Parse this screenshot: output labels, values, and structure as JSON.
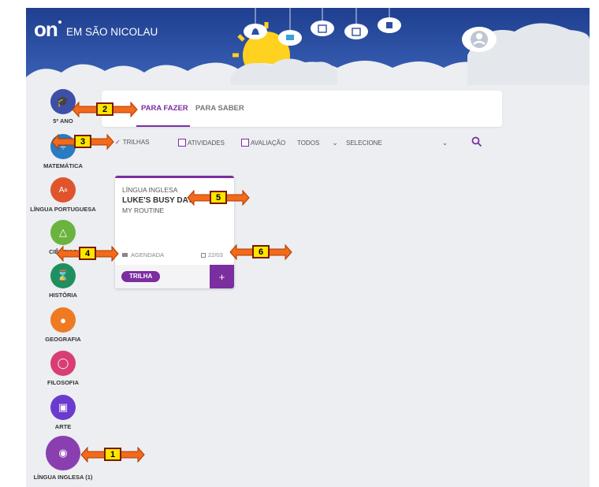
{
  "header": {
    "logo": "on",
    "school_name": "EM SÃO NICOLAU",
    "cloud_icons": [
      "bell-icon",
      "mail-icon",
      "calendar-icon",
      "chart-icon",
      "video-icon"
    ],
    "profile_icon": "user-avatar-icon"
  },
  "sidebar": {
    "items": [
      {
        "label": "5º ANO",
        "icon": "graduation-cap-icon",
        "color": "#3e4fa8"
      },
      {
        "label": "MATEMÁTICA",
        "icon": "math-icon",
        "color": "#2a7bc1"
      },
      {
        "label": "LÍNGUA PORTUGUESA",
        "icon": "letters-icon",
        "color": "#e0542c"
      },
      {
        "label": "CIÊNCIAS",
        "icon": "flask-icon",
        "color": "#6bb33f"
      },
      {
        "label": "HISTÓRIA",
        "icon": "hourglass-icon",
        "color": "#1f8f5f"
      },
      {
        "label": "GEOGRAFIA",
        "icon": "globe-icon",
        "color": "#ef7a22"
      },
      {
        "label": "FILOSOFIA",
        "icon": "bulb-icon",
        "color": "#d83e73"
      },
      {
        "label": "ARTE",
        "icon": "image-icon",
        "color": "#6b3bd0"
      },
      {
        "label": "LÍNGUA INGLESA (1)",
        "icon": "chat-icon",
        "color": "#8a3fb1"
      }
    ]
  },
  "tabs": [
    {
      "label": "PARA FAZER",
      "active": true
    },
    {
      "label": "PARA SABER",
      "active": false
    }
  ],
  "filters": {
    "trilhas": "TRILHAS",
    "atividades": "ATIVIDADES",
    "avaliacao": "AVALIAÇÃO",
    "todos": "TODOS",
    "selecione": "SELECIONE"
  },
  "card": {
    "subject": "LÍNGUA INGLESA",
    "title": "LUKE'S BUSY DAY",
    "subtitle": "MY ROUTINE",
    "status": "AGENDADA",
    "date": "22/03",
    "badge": "TRILHA",
    "plus": "+"
  },
  "callouts": [
    "1",
    "2",
    "3",
    "4",
    "5",
    "6"
  ],
  "colors": {
    "accent": "#7b2ea0",
    "header_sky": "#2d4fa0",
    "callout_fill": "#ffe600",
    "callout_arrow": "#f26a1b"
  }
}
